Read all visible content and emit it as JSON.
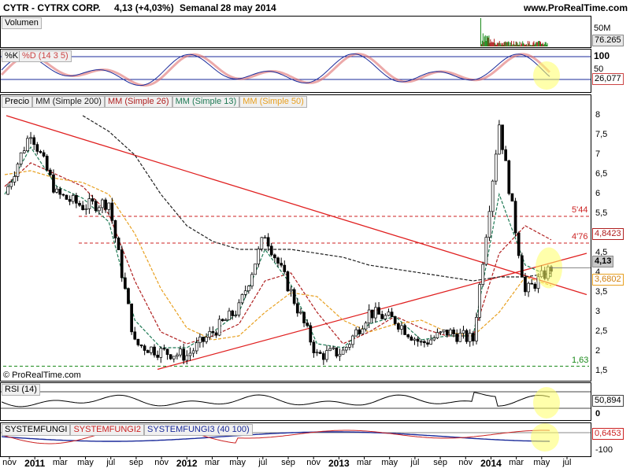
{
  "header": {
    "ticker": "CYTR - CYTRX CORP.",
    "quote": "4,13 (+4,03%)",
    "period": "Semanal",
    "date": "28 may 2014",
    "site": "www.ProRealTime.com"
  },
  "panels": {
    "volume": {
      "label": "Volumen",
      "axis_top": "50M",
      "value_tag": "76.265"
    },
    "stoch": {
      "k_label": "%K",
      "d_label": "%D (14 3 5)",
      "tick_100": "100",
      "tick_50": "50",
      "value_tag": "26,077"
    },
    "price": {
      "label": "Precio",
      "ma_labels": [
        "MM (Simple 200)",
        "MM (Simple 26)",
        "MM (Simple 13)",
        "MM (Simple 50)"
      ],
      "ma_colors": [
        "#202020",
        "#b02020",
        "#1f7a55",
        "#e8a020"
      ],
      "y_ticks": [
        "8",
        "7,5",
        "7",
        "6,5",
        "6",
        "5,5",
        "5",
        "4,5",
        "4",
        "3,5",
        "3",
        "2,5",
        "2",
        "1,5"
      ],
      "y_tick_values": [
        8,
        7.5,
        7,
        6.5,
        6,
        5.5,
        5,
        4.5,
        4,
        3.5,
        3,
        2.5,
        2,
        1.5
      ],
      "ylim": [
        1.3,
        8.5
      ],
      "levels": [
        {
          "label": "5'44",
          "value": 5.44,
          "color": "#cc2222"
        },
        {
          "label": "4'76",
          "value": 4.76,
          "color": "#cc2222"
        },
        {
          "label": "1,63",
          "value": 1.63,
          "color": "#1a8a1a"
        }
      ],
      "tags": {
        "ma26": "4,8423",
        "last": "4,13",
        "ma50": "3,6802"
      },
      "footer": "© ProRealTime.com"
    },
    "rsi": {
      "label": "RSI (14)",
      "value_tag": "50,894",
      "tick_0": "0"
    },
    "systemfungi": {
      "labels": [
        "SYSTEMFUNGI",
        "SYSTEMFUNGI2",
        "SYSTEMFUNGI3 (40 100)"
      ],
      "label_colors": [
        "#000000",
        "#cc2222",
        "#1a2a9a"
      ],
      "value_tag": "0,6453",
      "tick_neg100": "-100"
    }
  },
  "x_axis": {
    "labels": [
      {
        "t": "nov",
        "big": false
      },
      {
        "t": "2011",
        "big": true
      },
      {
        "t": "mar",
        "big": false
      },
      {
        "t": "may",
        "big": false
      },
      {
        "t": "jul",
        "big": false
      },
      {
        "t": "sep",
        "big": false
      },
      {
        "t": "nov",
        "big": false
      },
      {
        "t": "2012",
        "big": true
      },
      {
        "t": "mar",
        "big": false
      },
      {
        "t": "may",
        "big": false
      },
      {
        "t": "jul",
        "big": false
      },
      {
        "t": "sep",
        "big": false
      },
      {
        "t": "nov",
        "big": false
      },
      {
        "t": "2013",
        "big": true
      },
      {
        "t": "mar",
        "big": false
      },
      {
        "t": "may",
        "big": false
      },
      {
        "t": "jul",
        "big": false
      },
      {
        "t": "sep",
        "big": false
      },
      {
        "t": "nov",
        "big": false
      },
      {
        "t": "2014",
        "big": true
      },
      {
        "t": "mar",
        "big": false
      },
      {
        "t": "may",
        "big": false
      },
      {
        "t": "jul",
        "big": false
      }
    ]
  },
  "chart_data": {
    "type": "line",
    "title": "CYTR - CYTRX CORP.",
    "period": "Semanal",
    "ylim": [
      1.3,
      8.5
    ],
    "x": [
      "nov 2010",
      "2011",
      "mar",
      "may",
      "jul",
      "sep",
      "nov",
      "2012",
      "mar",
      "may",
      "jul",
      "sep",
      "nov",
      "2013",
      "mar",
      "may",
      "jul",
      "sep",
      "nov",
      "2014",
      "mar",
      "may 2014"
    ],
    "series": [
      {
        "name": "Precio",
        "values": [
          6.0,
          7.6,
          6.0,
          5.7,
          5.8,
          2.2,
          2.0,
          1.9,
          2.5,
          3.1,
          5.0,
          3.5,
          1.9,
          2.0,
          3.0,
          2.8,
          2.2,
          2.5,
          2.3,
          7.8,
          3.5,
          4.13
        ]
      },
      {
        "name": "MM (Simple 26)",
        "values": [
          6.2,
          6.8,
          6.5,
          6.2,
          5.5,
          3.8,
          2.5,
          2.2,
          2.4,
          2.7,
          3.8,
          4.0,
          3.0,
          2.2,
          2.5,
          2.9,
          2.6,
          2.4,
          2.4,
          4.5,
          5.2,
          4.8423
        ]
      },
      {
        "name": "MM (Simple 13)",
        "values": [
          6.0,
          7.2,
          6.2,
          5.9,
          5.3,
          2.8,
          2.1,
          2.1,
          2.5,
          3.0,
          4.6,
          3.7,
          2.2,
          2.1,
          2.7,
          2.9,
          2.3,
          2.4,
          2.4,
          6.0,
          4.2,
          3.9
        ]
      },
      {
        "name": "MM (Simple 50)",
        "values": [
          6.5,
          6.6,
          6.4,
          6.3,
          6.0,
          5.0,
          3.6,
          2.6,
          2.3,
          2.4,
          3.0,
          3.5,
          3.4,
          2.8,
          2.5,
          2.7,
          2.8,
          2.5,
          2.4,
          3.0,
          3.9,
          3.6802
        ]
      },
      {
        "name": "MM (Simple 200)",
        "values": [
          null,
          null,
          null,
          8.0,
          7.6,
          7.0,
          6.0,
          5.2,
          4.8,
          4.6,
          4.6,
          4.6,
          4.5,
          4.4,
          4.2,
          4.1,
          4.0,
          3.9,
          3.8,
          3.9,
          3.9,
          4.0
        ]
      }
    ],
    "levels": [
      5.44,
      4.76,
      1.63
    ],
    "last": 4.13,
    "change_pct": 4.03,
    "indicators": {
      "stoch_d": 26.077,
      "rsi": 50.894,
      "systemfungi": 0.6453,
      "volume": 76.265
    }
  }
}
